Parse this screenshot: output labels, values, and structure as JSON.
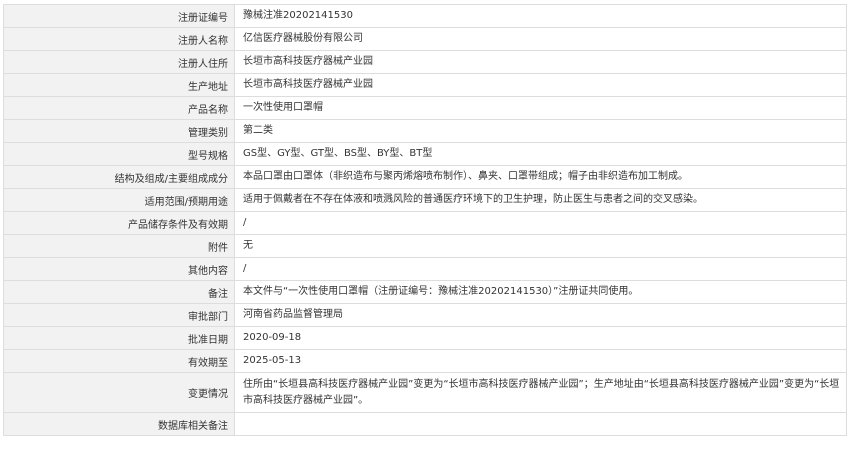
{
  "rows": [
    {
      "label": "注册证编号",
      "value": "豫械注准20202141530"
    },
    {
      "label": "注册人名称",
      "value": "亿信医疗器械股份有限公司"
    },
    {
      "label": "注册人住所",
      "value": "长垣市高科技医疗器械产业园"
    },
    {
      "label": "生产地址",
      "value": "长垣市高科技医疗器械产业园"
    },
    {
      "label": "产品名称",
      "value": "一次性使用口罩帽"
    },
    {
      "label": "管理类别",
      "value": "第二类"
    },
    {
      "label": "型号规格",
      "value": "GS型、GY型、GT型、BS型、BY型、BT型"
    },
    {
      "label": "结构及组成/主要组成成分",
      "value": "本品口罩由口罩体（非织造布与聚丙烯熔喷布制作）、鼻夹、口罩带组成；帽子由非织造布加工制成。"
    },
    {
      "label": "适用范围/预期用途",
      "value": "适用于佩戴者在不存在体液和喷溅风险的普通医疗环境下的卫生护理，防止医生与患者之间的交叉感染。"
    },
    {
      "label": "产品储存条件及有效期",
      "value": "/"
    },
    {
      "label": "附件",
      "value": "无"
    },
    {
      "label": "其他内容",
      "value": "/"
    },
    {
      "label": "备注",
      "value": "本文件与“一次性使用口罩帽（注册证编号：豫械注准20202141530）”注册证共同使用。"
    },
    {
      "label": "审批部门",
      "value": "河南省药品监督管理局"
    },
    {
      "label": "批准日期",
      "value": "2020-09-18"
    },
    {
      "label": "有效期至",
      "value": "2025-05-13"
    },
    {
      "label": "变更情况",
      "value": "住所由“长垣县高科技医疗器械产业园”变更为“长垣市高科技医疗器械产业园”；生产地址由“长垣县高科技医疗器械产业园”变更为“长垣市高科技医疗器械产业园”。"
    },
    {
      "label": "数据库相关备注",
      "value": ""
    }
  ]
}
